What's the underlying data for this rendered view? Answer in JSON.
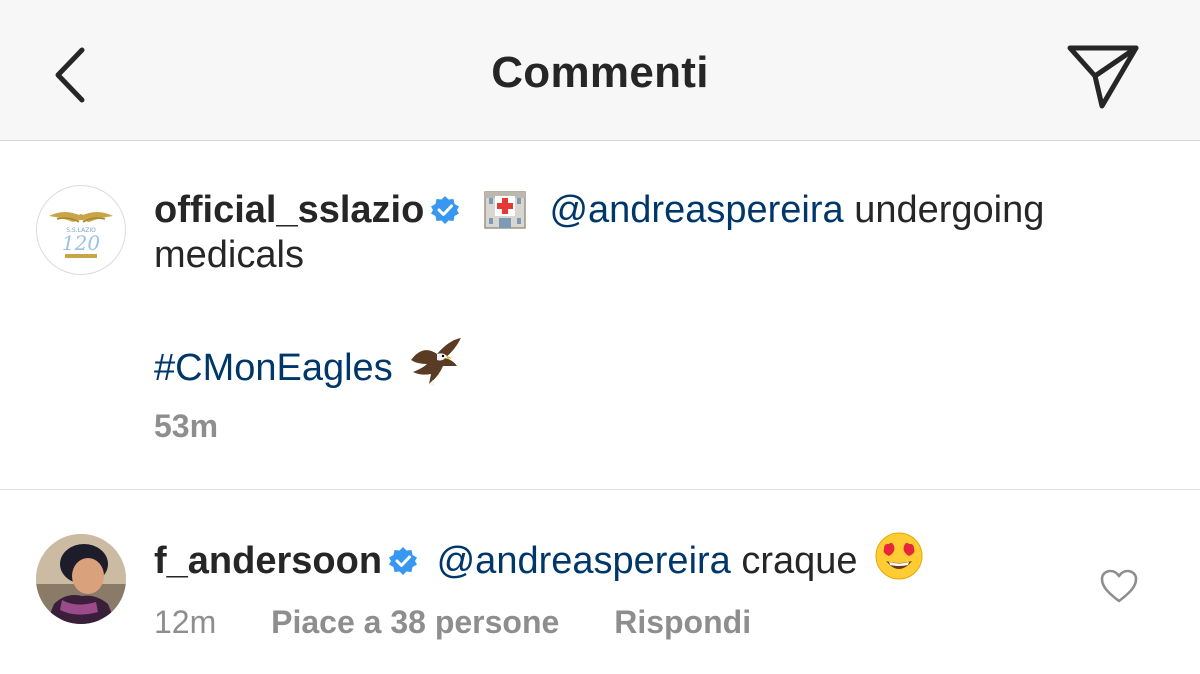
{
  "header": {
    "title": "Commenti",
    "back_icon": "chevron-left-icon",
    "send_icon": "paper-plane-icon"
  },
  "post": {
    "username": "official_sslazio",
    "verified": true,
    "emoji_hospital": "hospital-emoji",
    "mention": "@andreaspereira",
    "text_1": "undergoing",
    "text_2": "medicals",
    "hashtag": "#CMonEagles",
    "emoji_eagle": "eagle-emoji",
    "time": "53m"
  },
  "comment": {
    "username": "f_andersoon",
    "verified": true,
    "mention": "@andreaspereira",
    "text": "craque",
    "emoji": "heart-eyes-emoji",
    "time": "12m",
    "likes_label": "Piace a 38 persone",
    "reply_label": "Rispondi"
  },
  "colors": {
    "link_blue": "#00376b",
    "verified_blue": "#3897f0",
    "meta_gray": "#8e8e8e",
    "header_bg": "#f7f7f7"
  }
}
